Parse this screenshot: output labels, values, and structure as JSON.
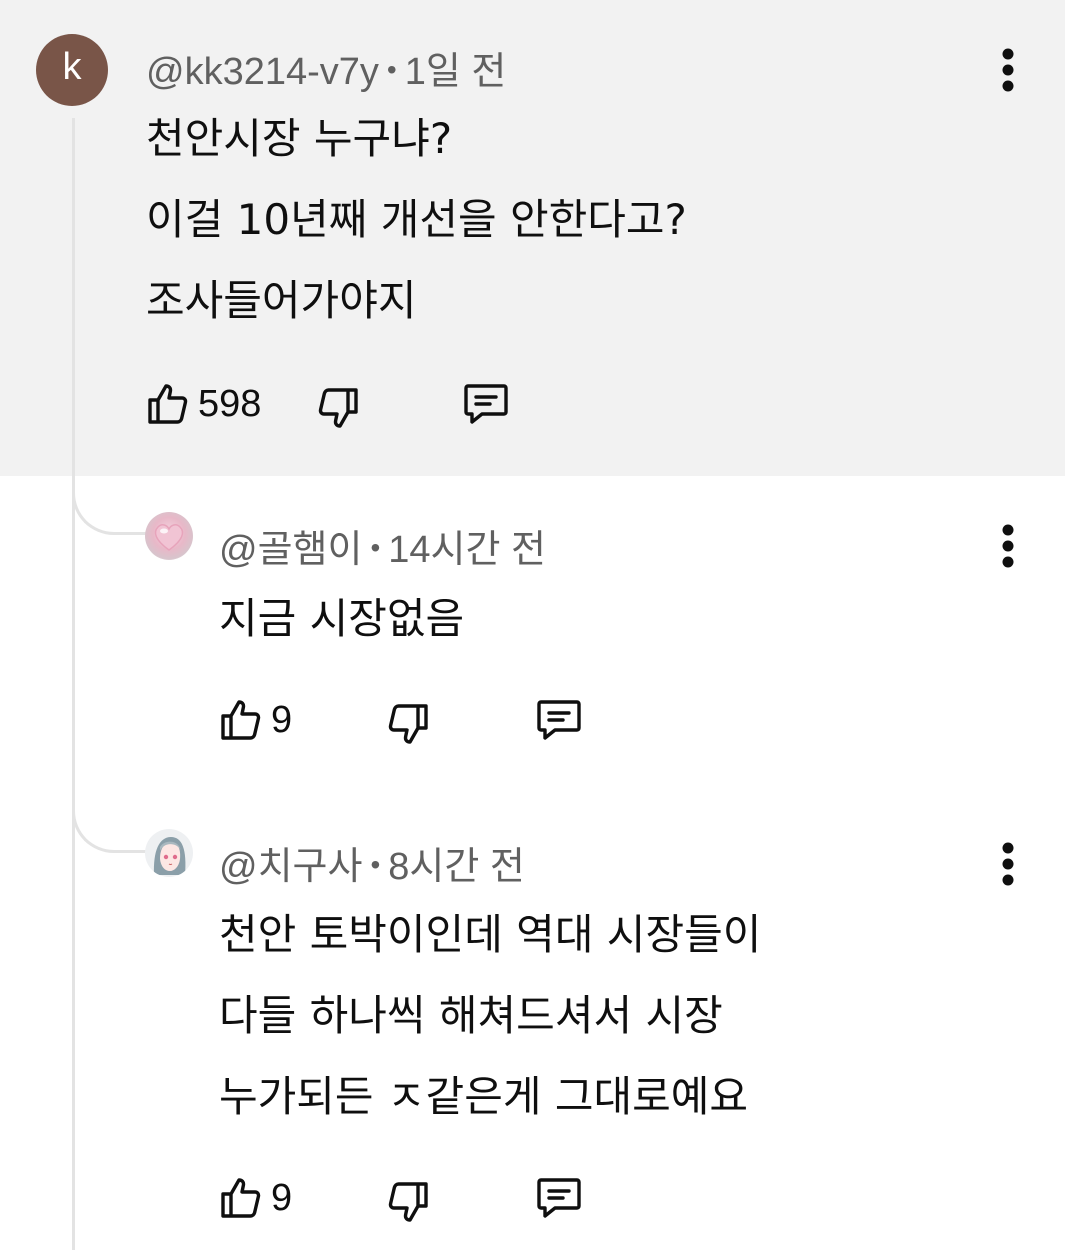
{
  "comments": [
    {
      "avatar_letter": "k",
      "avatar_color": "#795548",
      "handle": "@kk3214-v7y",
      "separator": "•",
      "time": "1일 전",
      "lines": [
        "천안시장 누구냐?",
        "이걸 10년째 개선을 안한다고?",
        "조사들어가야지"
      ],
      "likes": "598",
      "icons": [
        "thumbs-up-icon",
        "thumbs-down-icon",
        "reply-icon",
        "more-vert-icon"
      ]
    }
  ],
  "replies": [
    {
      "handle": "@골햄이",
      "separator": "•",
      "time": "14시간 전",
      "lines": [
        "지금 시장없음"
      ],
      "likes": "9"
    },
    {
      "handle": "@치구사",
      "separator": "•",
      "time": "8시간 전",
      "lines": [
        "천안 토박이인데 역대 시장들이",
        "다들 하나씩 해쳐드셔서 시장",
        "누가되든 ㅈ같은게 그대로예요"
      ],
      "likes": "9"
    }
  ]
}
